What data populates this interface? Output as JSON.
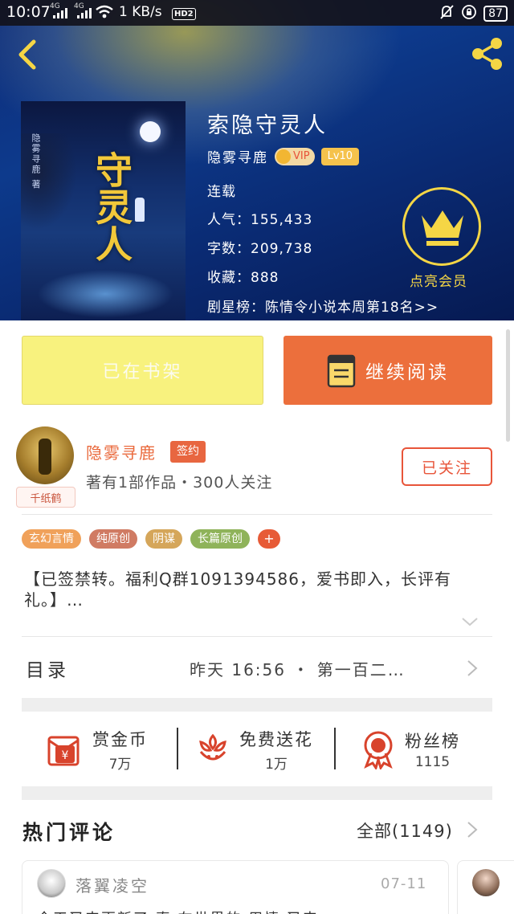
{
  "status_bar": {
    "time": "10:07",
    "network_1": "4G",
    "network_2": "4G",
    "speed": "1 KB/s",
    "hd": "HD2",
    "battery": "87"
  },
  "book": {
    "title": "索隐守灵人",
    "author": "隐雾寻鹿",
    "vip_label": "VIP",
    "level": "Lv10",
    "status": "连载",
    "popularity": "人气：155,433",
    "word_count": "字数：209,738",
    "favorites": "收藏：888",
    "ranking": "剧星榜：陈情令小说本周第18名>>",
    "cover_title": "守灵人",
    "cover_author": "隐雾寻鹿 著"
  },
  "vip_promo": {
    "label": "点亮会员"
  },
  "actions": {
    "shelf_label": "已在书架",
    "read_label": "继续阅读"
  },
  "author": {
    "name": "隐雾寻鹿",
    "signed": "签约",
    "avatar_tag": "千纸鹤",
    "stats": "著有1部作品・300人关注",
    "follow_label": "已关注"
  },
  "tags": [
    {
      "label": "玄幻言情",
      "color": "#f0a15a"
    },
    {
      "label": "纯原创",
      "color": "#d07b63"
    },
    {
      "label": "阴谋",
      "color": "#d5a65a"
    },
    {
      "label": "长篇原创",
      "color": "#8fb35a"
    }
  ],
  "tags_more": "+",
  "description": "【已签禁转。福利Q群1091394586，爱书即入，长评有礼。】…",
  "toc": {
    "label": "目录",
    "latest": "昨天 16:56 ・ 第一百二…"
  },
  "rewards": {
    "coin_label": "赏金币",
    "coin_value": "7万",
    "flower_label": "免费送花",
    "flower_value": "1万",
    "fans_label": "粉丝榜",
    "fans_value": "1115"
  },
  "comments": {
    "title": "热门评论",
    "all_label": "全部(1149)",
    "items": [
      {
        "user": "落翼凌空",
        "date": "07-11",
        "text": "今天又来更新了 真 在世界的 用情 又来"
      }
    ]
  },
  "colors": {
    "accent_orange": "#ec6f3c",
    "shelf_yellow": "#f8f27e",
    "vip_gold": "#f5d645",
    "header_blue": "#0d3a8c"
  }
}
